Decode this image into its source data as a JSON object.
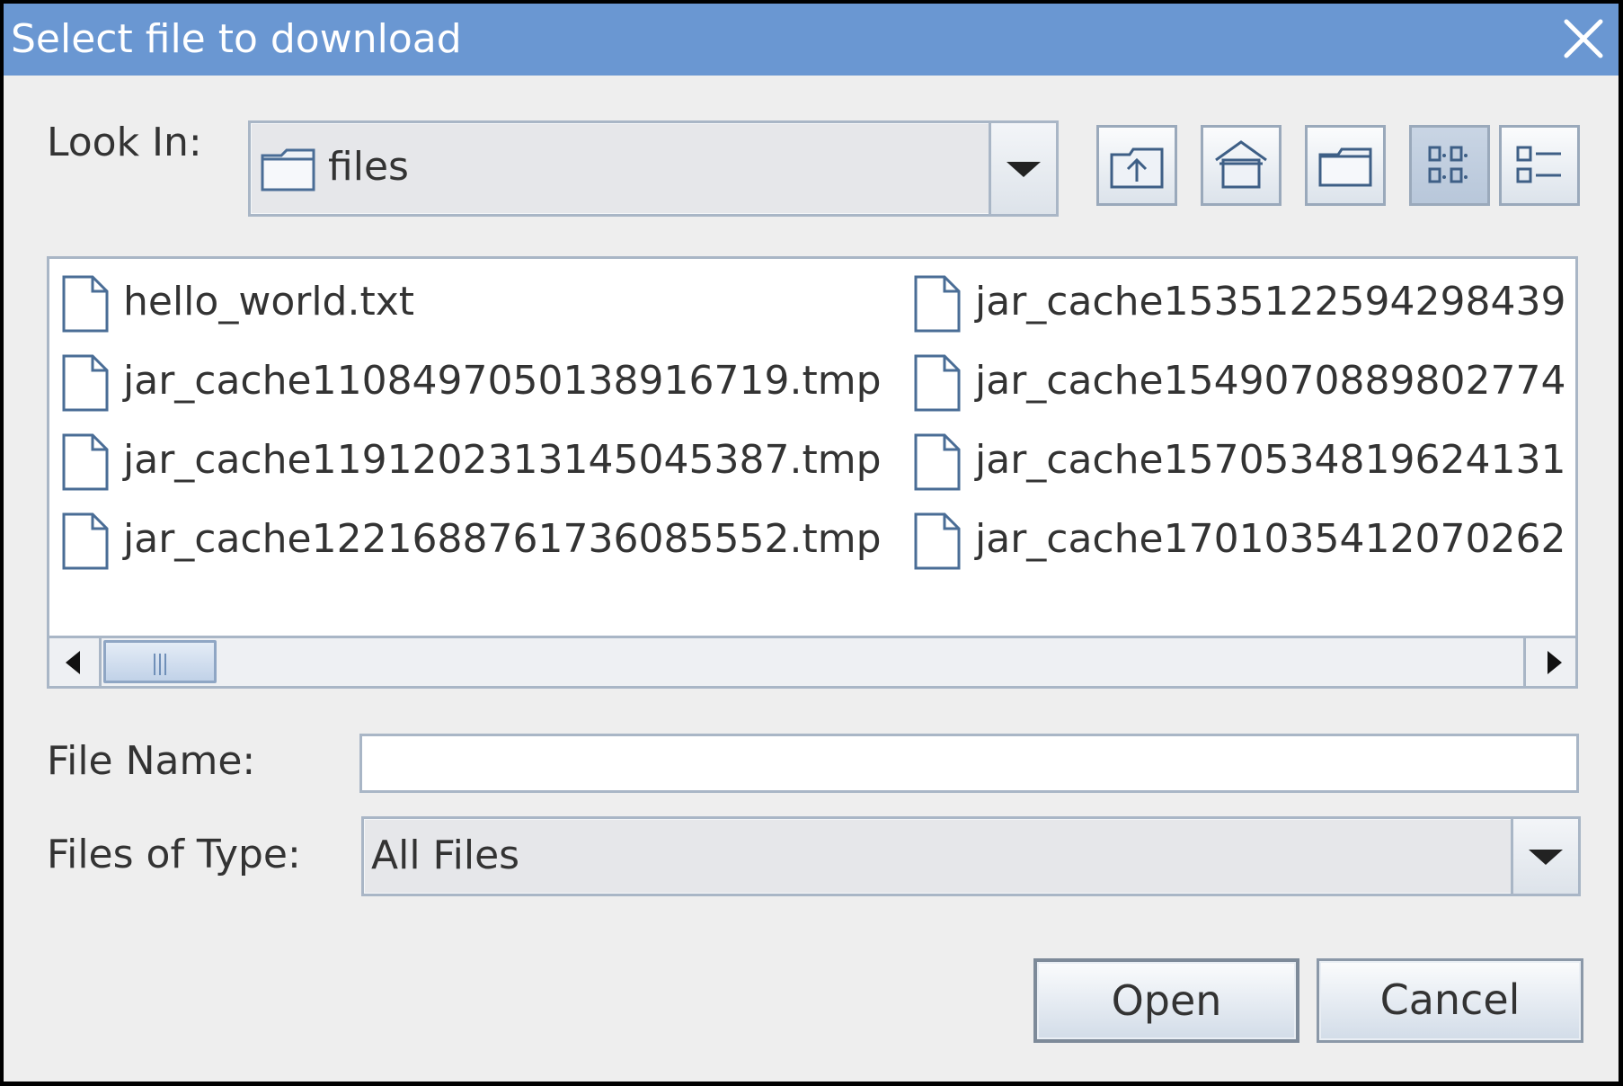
{
  "dialog": {
    "title": "Select file to download",
    "close_icon": "close-icon"
  },
  "look_in": {
    "label": "Look In:",
    "mnemonic": "I",
    "value": "files",
    "folder_icon": "folder-icon"
  },
  "toolbar": {
    "buttons": [
      {
        "name": "up-one-level-button",
        "icon": "folder-up-icon"
      },
      {
        "name": "home-button",
        "icon": "home-icon"
      },
      {
        "name": "new-folder-button",
        "icon": "new-folder-icon"
      },
      {
        "name": "list-view-button",
        "icon": "list-view-icon",
        "pressed": true
      },
      {
        "name": "details-view-button",
        "icon": "details-view-icon",
        "pressed": false
      }
    ]
  },
  "files": {
    "items": [
      {
        "name": "hello_world.txt"
      },
      {
        "name": "jar_cache1108497050138916719.tmp"
      },
      {
        "name": "jar_cache1191202313145045387.tmp"
      },
      {
        "name": "jar_cache1221688761736085552.tmp"
      },
      {
        "name": "jar_cache1535122594298439"
      },
      {
        "name": "jar_cache1549070889802774"
      },
      {
        "name": "jar_cache1570534819624131"
      },
      {
        "name": "jar_cache1701035412070262"
      }
    ]
  },
  "file_name": {
    "label": "File Name:",
    "value": ""
  },
  "file_type": {
    "label": "Files of Type:",
    "value": "All Files"
  },
  "buttons": {
    "open": "Open",
    "cancel": "Cancel"
  },
  "colors": {
    "titlebar": "#6a97d2",
    "background": "#eeeeee",
    "border": "#a9b6c6"
  }
}
